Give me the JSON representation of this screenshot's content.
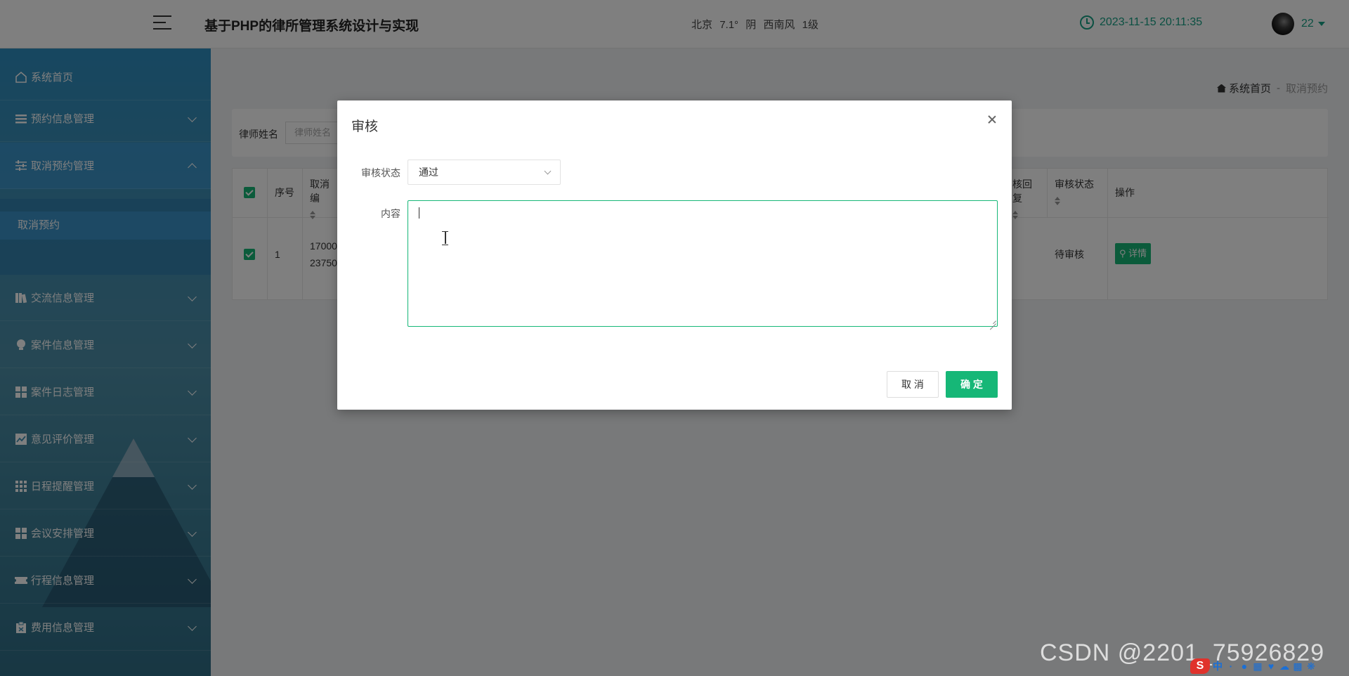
{
  "header": {
    "title": "基于PHP的律所管理系统设计与实现",
    "weather": [
      "北京",
      "7.1°",
      "阴",
      "西南风",
      "1级"
    ],
    "datetime": "2023-11-15 20:11:35",
    "user": "22",
    "accent_color": "#16a085"
  },
  "sidebar": {
    "items": [
      {
        "label": "系统首页",
        "icon": "home-icon"
      },
      {
        "label": "预约信息管理",
        "icon": "list-icon"
      },
      {
        "label": "取消预约管理",
        "icon": "sliders-icon"
      },
      {
        "label": "交流信息管理",
        "icon": "book-icon"
      },
      {
        "label": "案件信息管理",
        "icon": "bulb-icon"
      },
      {
        "label": "案件日志管理",
        "icon": "grid-icon"
      },
      {
        "label": "意见评价管理",
        "icon": "chart-icon"
      },
      {
        "label": "日程提醒管理",
        "icon": "apps-icon"
      },
      {
        "label": "会议安排管理",
        "icon": "grid-icon"
      },
      {
        "label": "行程信息管理",
        "icon": "ticket-icon"
      },
      {
        "label": "费用信息管理",
        "icon": "clipboard-icon"
      }
    ],
    "subitem": "取消预约"
  },
  "breadcrumb": {
    "home": "系统首页",
    "sep": "-",
    "current": "取消预约"
  },
  "search": {
    "label": "律师姓名",
    "placeholder": "律师姓名"
  },
  "table": {
    "headers": [
      "序号",
      "取消编",
      "核回复",
      "审核状态",
      "操作"
    ],
    "row": {
      "index": "1",
      "code_line1": "17000",
      "code_line2": "23750",
      "status": "待审核",
      "action": "详情"
    }
  },
  "dialog": {
    "title": "审核",
    "status_label": "审核状态",
    "status_value": "通过",
    "content_label": "内容",
    "content_value": "",
    "cancel": "取 消",
    "confirm": "确 定",
    "confirm_color": "#16b777"
  },
  "watermark": "CSDN @2201_75926829"
}
